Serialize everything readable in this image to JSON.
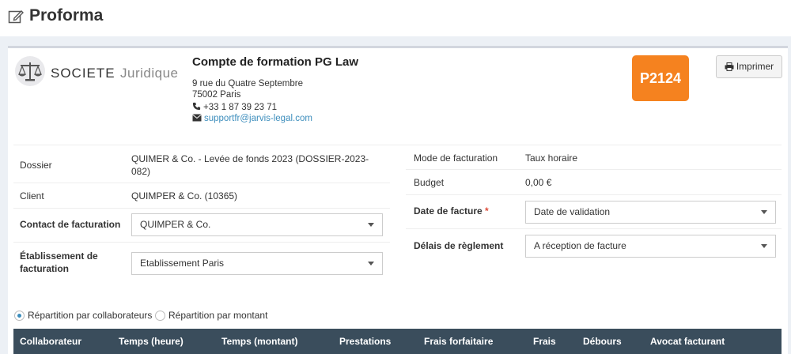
{
  "page": {
    "title": "Proforma"
  },
  "logo": {
    "word1": "SOCIETE",
    "word2": "Juridique"
  },
  "company": {
    "name": "Compte de formation PG Law",
    "address1": "9 rue du Quatre Septembre",
    "address2": "75002 Paris",
    "phone": "+33 1 87 39 23 71",
    "email": "supportfr@jarvis-legal.com"
  },
  "badge": "P2124",
  "print_label": "Imprimer",
  "left": {
    "dossier_label": "Dossier",
    "dossier_value": "QUIMER & Co. - Levée de fonds 2023 (DOSSIER-2023-082)",
    "client_label": "Client",
    "client_value": "QUIMPER & Co. (10365)",
    "contact_label": "Contact de facturation",
    "contact_value": "QUIMPER & Co.",
    "etab_label": "Établissement de facturation",
    "etab_value": "Etablissement Paris"
  },
  "right": {
    "mode_label": "Mode de facturation",
    "mode_value": "Taux horaire",
    "budget_label": "Budget",
    "budget_value": "0,00 €",
    "date_label": "Date de facture",
    "date_required": "*",
    "date_value": "Date de validation",
    "delais_label": "Délais de règlement",
    "delais_value": "A réception de facture"
  },
  "radios": {
    "collab": "Répartition par collaborateurs",
    "montant": "Répartition par montant",
    "selected": "collab"
  },
  "table": {
    "headers": [
      "Collaborateur",
      "Temps (heure)",
      "Temps (montant)",
      "Prestations",
      "Frais forfaitaire",
      "Frais",
      "Débours",
      "Avocat facturant"
    ]
  },
  "colors": {
    "badge": "#f5821f",
    "table_header": "#3a4d5c",
    "link": "#3c8dbc"
  }
}
